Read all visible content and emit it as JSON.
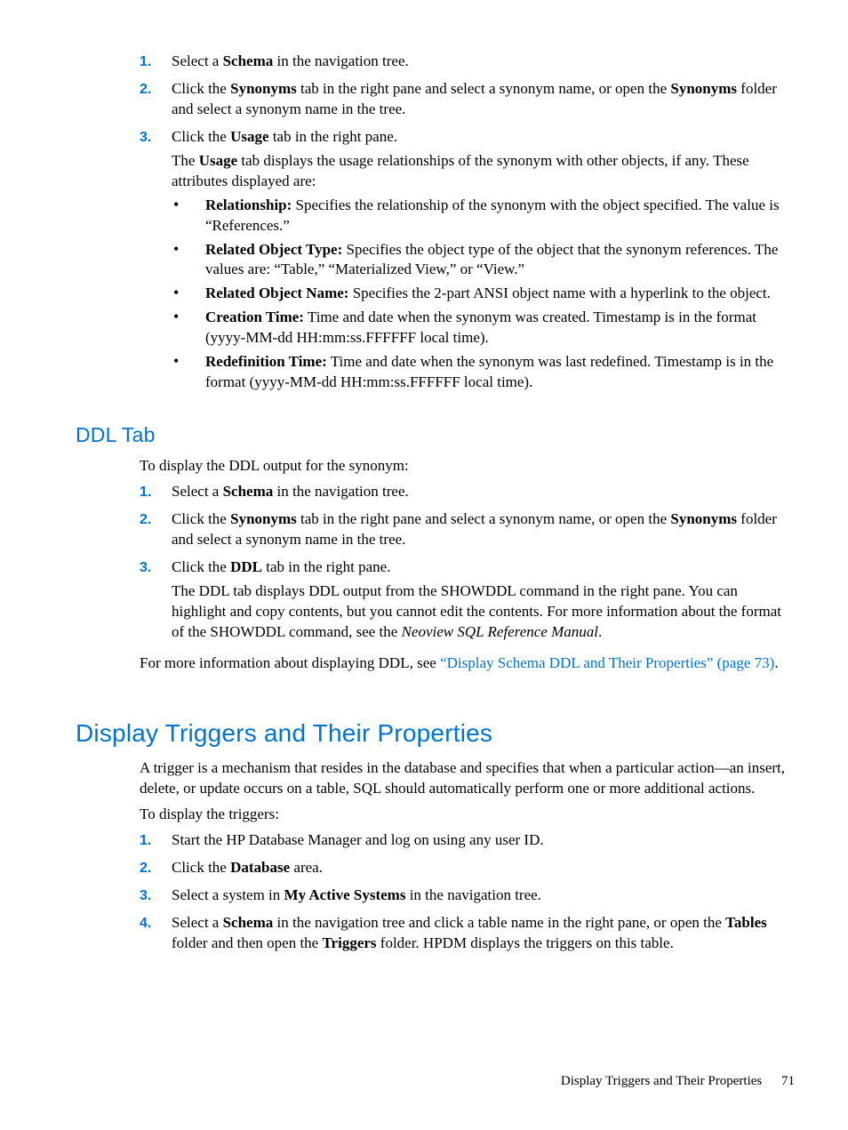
{
  "section1": {
    "items": [
      {
        "num": "1.",
        "parts": [
          "Select a ",
          "Schema",
          " in the navigation tree."
        ]
      },
      {
        "num": "2.",
        "parts": [
          "Click the ",
          "Synonyms",
          " tab in the right pane and select a synonym name, or open the ",
          "Synonyms",
          " folder and select a synonym name in the tree."
        ]
      },
      {
        "num": "3.",
        "parts": [
          "Click the ",
          "Usage",
          " tab in the right pane."
        ],
        "follow": [
          "The ",
          "Usage",
          " tab displays the usage relationships of the synonym with other objects, if any. These attributes displayed are:"
        ],
        "bullets": [
          {
            "label": "Relationship:",
            "text": " Specifies the relationship of the synonym with the object specified. The value is “References.”"
          },
          {
            "label": "Related Object Type:",
            "text": " Specifies the object type of the object that the synonym references. The values are: “Table,” “Materialized View,” or “View.”"
          },
          {
            "label": "Related Object Name:",
            "text": " Specifies the 2-part ANSI object name with a hyperlink to the object."
          },
          {
            "label": "Creation Time:",
            "text": " Time and date when the synonym was created. Timestamp is in the format (yyyy-MM-dd HH:mm:ss.FFFFFF local time)."
          },
          {
            "label": "Redefinition Time:",
            "text": " Time and date when the synonym was last redefined. Timestamp is in the format (yyyy-MM-dd HH:mm:ss.FFFFFF local time)."
          }
        ]
      }
    ]
  },
  "ddl": {
    "heading": "DDL Tab",
    "intro": "To display the DDL output for the synonym:",
    "items": [
      {
        "num": "1.",
        "parts": [
          "Select a ",
          "Schema",
          " in the navigation tree."
        ]
      },
      {
        "num": "2.",
        "parts": [
          "Click the ",
          "Synonyms",
          " tab in the right pane and select a synonym name, or open the ",
          "Synonyms",
          " folder and select a synonym name in the tree."
        ]
      },
      {
        "num": "3.",
        "parts": [
          "Click the ",
          "DDL",
          " tab in the right pane."
        ],
        "follow_plain": "The DDL tab displays DDL output from the SHOWDDL command in the right pane. You can highlight and copy contents, but you cannot edit the contents. For more information about the format of the SHOWDDL command, see the ",
        "follow_italic": "Neoview SQL Reference Manual",
        "follow_end": "."
      }
    ],
    "closing_pre": "For more information about displaying DDL, see ",
    "closing_link": "“Display Schema DDL and Their Properties” (page 73)",
    "closing_post": "."
  },
  "triggers": {
    "heading": "Display Triggers and Their Properties",
    "intro": "A trigger is a mechanism that resides in the database and specifies that when a particular action—an insert, delete, or update occurs on a table, SQL should automatically perform one or more additional actions.",
    "intro2": "To display the triggers:",
    "items": [
      {
        "num": "1.",
        "plain": "Start the HP Database Manager and log on using any user ID."
      },
      {
        "num": "2.",
        "parts": [
          "Click the ",
          "Database",
          " area."
        ]
      },
      {
        "num": "3.",
        "parts": [
          "Select a system in ",
          "My Active Systems",
          " in the navigation tree."
        ]
      },
      {
        "num": "4.",
        "parts": [
          "Select a ",
          "Schema",
          " in the navigation tree and click a table name in the right pane, or open the ",
          "Tables",
          " folder and then open the ",
          "Triggers",
          " folder. HPDM displays the triggers on this table."
        ]
      }
    ]
  },
  "footer": {
    "title": "Display Triggers and Their Properties",
    "page": "71"
  }
}
